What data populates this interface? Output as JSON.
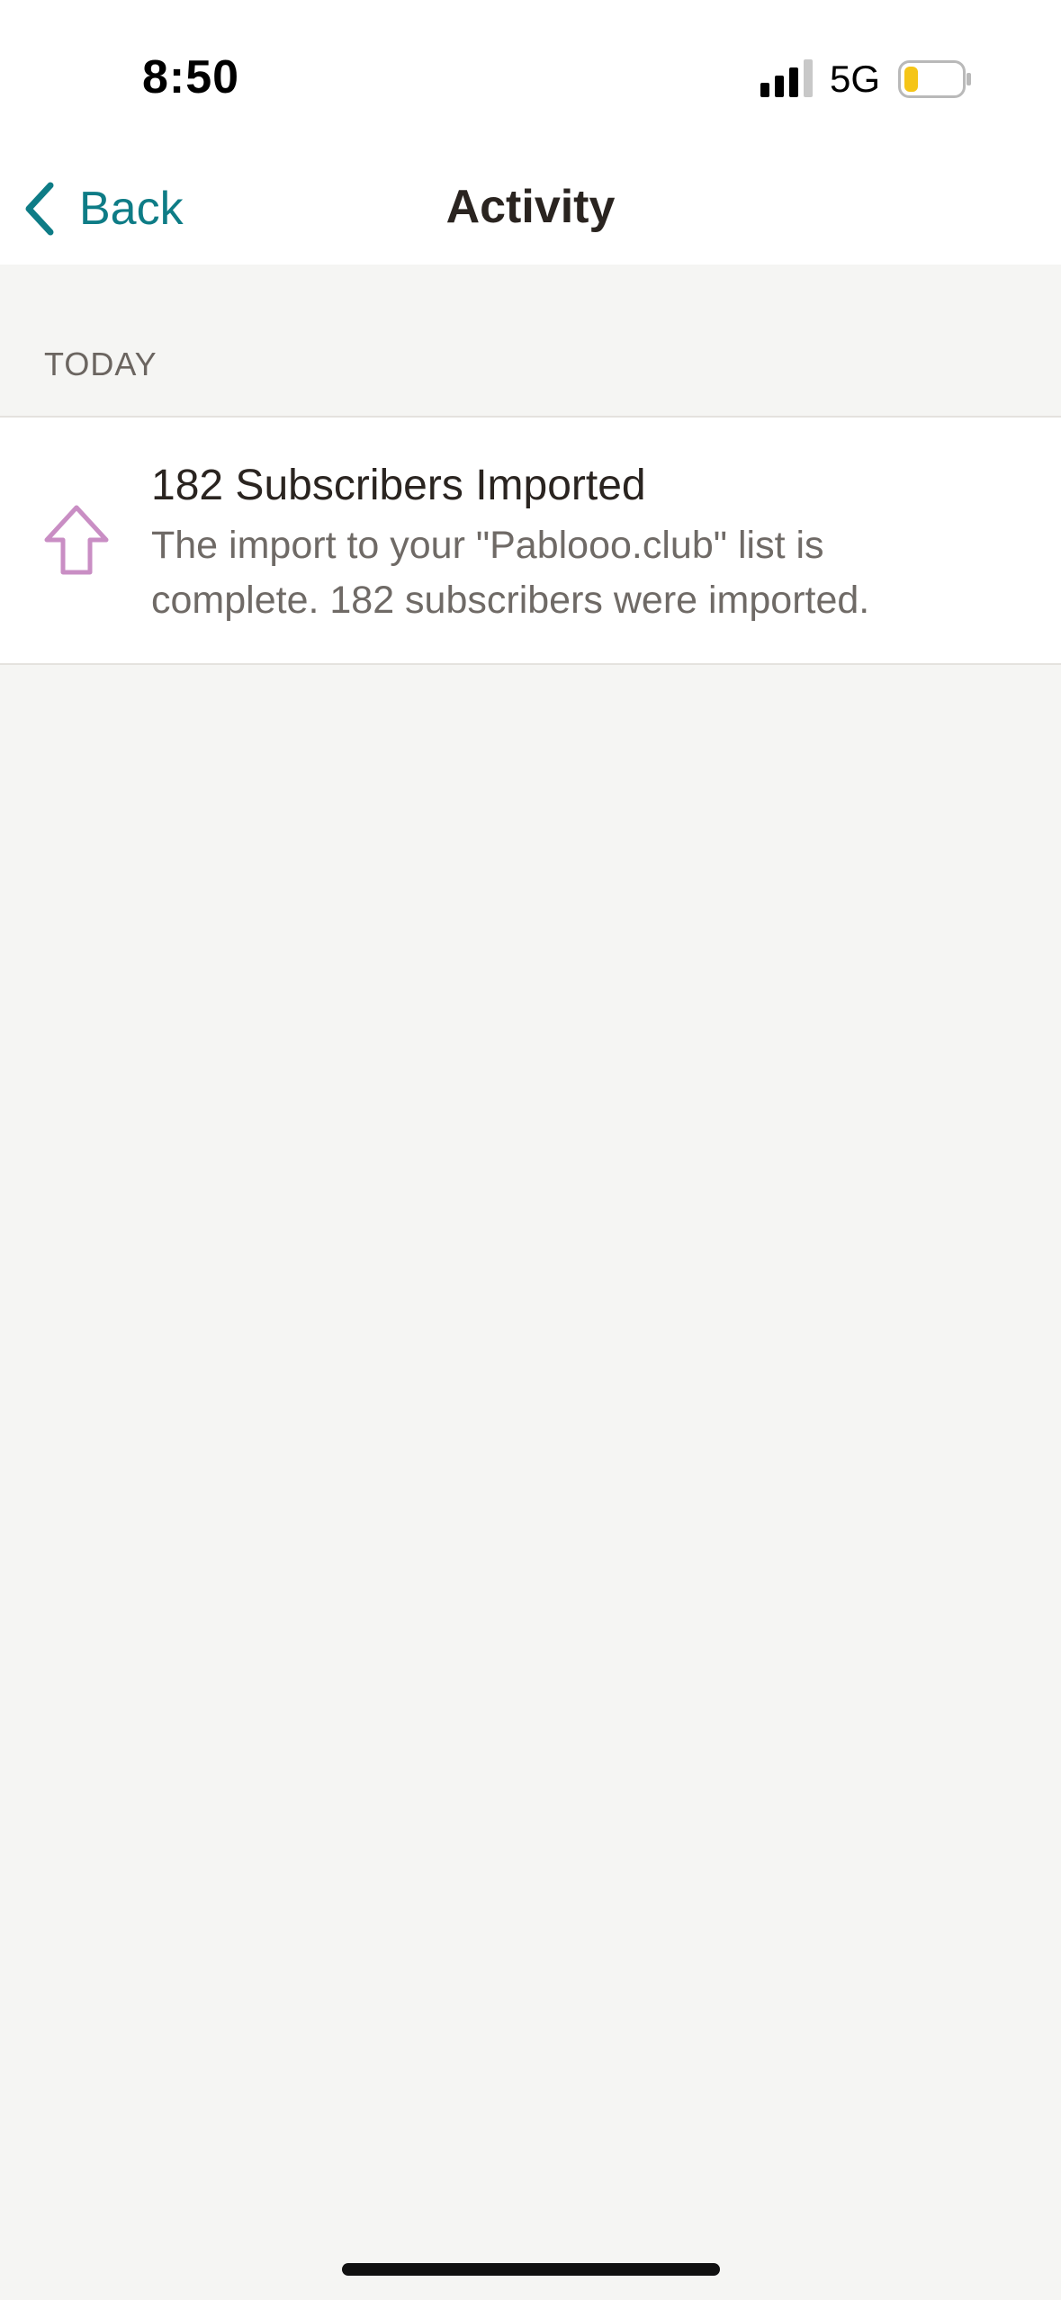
{
  "status_bar": {
    "time": "8:50",
    "network": "5G",
    "battery_color": "#f5c518"
  },
  "nav": {
    "back_label": "Back",
    "title": "Activity",
    "accent_color": "#0e7c86"
  },
  "section": {
    "label": "TODAY"
  },
  "activity": {
    "items": [
      {
        "icon": "upload-arrow-icon",
        "icon_color": "#c98ec4",
        "title": "182 Subscribers Imported",
        "description": "The import to your \"Pablooo.club\" list is complete. 182 subscribers were imported."
      }
    ]
  }
}
